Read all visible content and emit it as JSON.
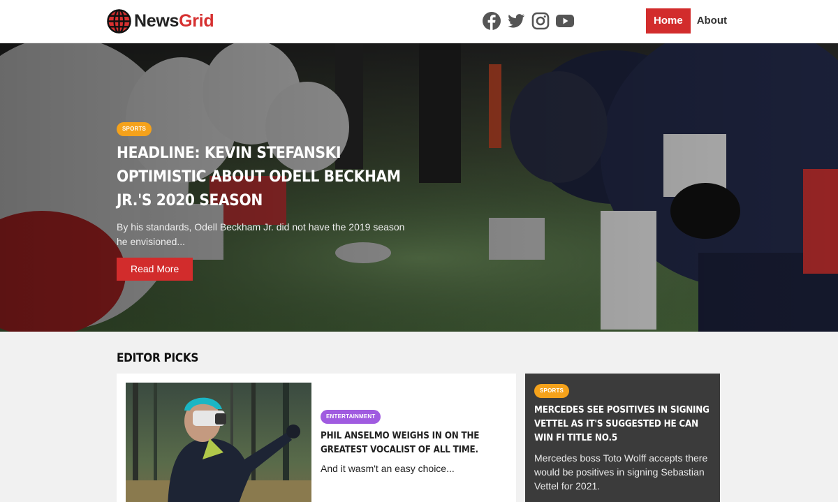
{
  "brand": {
    "name_part1": "News",
    "name_part2": "Grid",
    "logo_icon": "globe-icon",
    "accent_color": "#d22c2c"
  },
  "social": [
    {
      "name": "facebook-icon"
    },
    {
      "name": "twitter-icon"
    },
    {
      "name": "instagram-icon"
    },
    {
      "name": "youtube-icon"
    }
  ],
  "nav": {
    "home_label": "Home",
    "about_label": "About"
  },
  "hero": {
    "category": "SPORTS",
    "title": "Headline: Kevin Stefanski optimistic about Odell Beckham Jr.'s 2020 season",
    "excerpt": "By his standards, Odell Beckham Jr. did not have the 2019 season he envisioned...",
    "button_label": "Read More"
  },
  "editor_picks": {
    "heading": "Editor Picks",
    "main": {
      "category": "ENTERTAINMENT",
      "title": "Phil Anselmo weighs in on the greatest vocalist of all time.",
      "excerpt": "And it wasm't an easy choice..."
    },
    "side": {
      "category": "SPORTS",
      "title": "Mercedes see positives in signing Vettel as it's suggested he can win fi title no.5",
      "excerpt": "Mercedes boss Toto Wolff accepts there would be positives in signing Sebastian Vettel for 2021."
    }
  },
  "colors": {
    "badge_sports": "#f5a21b",
    "badge_entertainment": "#a05be0",
    "dark_card": "#3b3b3b"
  }
}
